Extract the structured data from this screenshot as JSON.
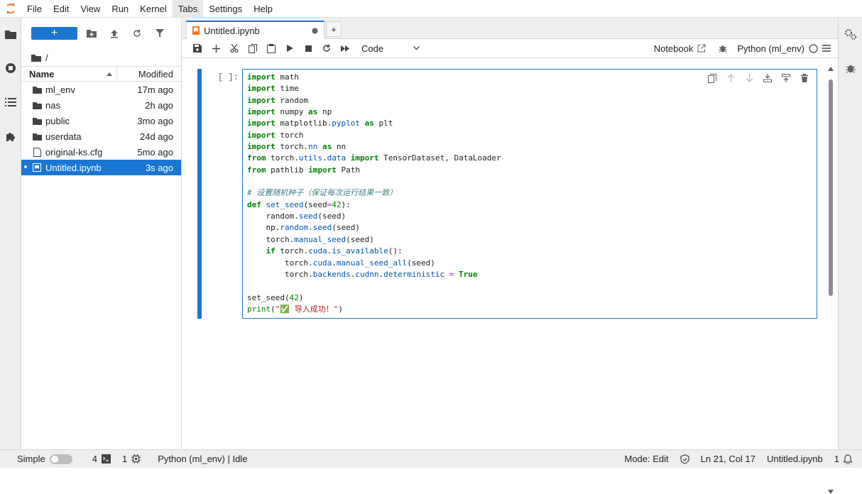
{
  "menubar": {
    "items": [
      "File",
      "Edit",
      "View",
      "Run",
      "Kernel",
      "Tabs",
      "Settings",
      "Help"
    ],
    "active": "Tabs"
  },
  "filebrowser": {
    "new_label": "+",
    "path": "/",
    "col_name": "Name",
    "col_modified": "Modified",
    "files": [
      {
        "name": "ml_env",
        "modified": "17m ago",
        "kind": "folder"
      },
      {
        "name": "nas",
        "modified": "2h ago",
        "kind": "folder"
      },
      {
        "name": "public",
        "modified": "3mo ago",
        "kind": "folder"
      },
      {
        "name": "userdata",
        "modified": "24d ago",
        "kind": "folder"
      },
      {
        "name": "original-ks.cfg",
        "modified": "5mo ago",
        "kind": "file"
      },
      {
        "name": "Untitled.ipynb",
        "modified": "3s ago",
        "kind": "notebook",
        "selected": true
      }
    ]
  },
  "tab": {
    "label": "Untitled.ipynb",
    "add": "+"
  },
  "toolbar": {
    "cell_type": "Code",
    "notebook_label": "Notebook",
    "kernel_name": "Python (ml_env)"
  },
  "cell": {
    "prompt": "[ ]:",
    "code_lines": [
      "import math",
      "import time",
      "import random",
      "import numpy as np",
      "import matplotlib.pyplot as plt",
      "import torch",
      "import torch.nn as nn",
      "from torch.utils.data import TensorDataset, DataLoader",
      "from pathlib import Path",
      "",
      "# 设置随机种子（保证每次运行结果一致）",
      "def set_seed(seed=42):",
      "    random.seed(seed)",
      "    np.random.seed(seed)",
      "    torch.manual_seed(seed)",
      "    if torch.cuda.is_available():",
      "        torch.cuda.manual_seed_all(seed)",
      "        torch.backends.cudnn.deterministic = True",
      "",
      "set_seed(42)",
      "print(\"✅ 导入成功！\")"
    ]
  },
  "statusbar": {
    "mode_toggle": "Simple",
    "terminals": "4",
    "kernels": "1",
    "kernel_status": "Python (ml_env) | Idle",
    "mode": "Mode: Edit",
    "cursor": "Ln 21, Col 17",
    "file": "Untitled.ipynb",
    "notifications": "1"
  },
  "colors": {
    "accent": "#1976d2",
    "orange": "#f37726"
  }
}
